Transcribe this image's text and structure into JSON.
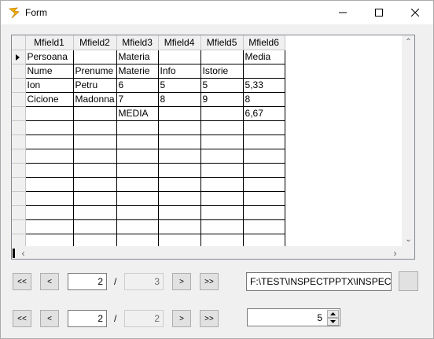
{
  "window": {
    "title": "Form"
  },
  "grid": {
    "columns": [
      "Mfield1",
      "Mfield2",
      "Mfield3",
      "Mfield4",
      "Mfield5",
      "Mfield6"
    ],
    "rows": [
      [
        "Persoana",
        "",
        "Materia",
        "",
        "",
        "Media"
      ],
      [
        "Nume",
        "Prenume",
        "Materie",
        "Info",
        "Istorie",
        ""
      ],
      [
        "Ion",
        "Petru",
        "6",
        "5",
        "5",
        "5,33"
      ],
      [
        "Cicione",
        "Madonna",
        "7",
        "8",
        "9",
        "8"
      ],
      [
        "",
        "",
        "MEDIA",
        "",
        "",
        "6,67"
      ],
      [
        "",
        "",
        "",
        "",
        "",
        ""
      ],
      [
        "",
        "",
        "",
        "",
        "",
        ""
      ],
      [
        "",
        "",
        "",
        "",
        "",
        ""
      ],
      [
        "",
        "",
        "",
        "",
        "",
        ""
      ],
      [
        "",
        "",
        "",
        "",
        "",
        ""
      ],
      [
        "",
        "",
        "",
        "",
        "",
        ""
      ],
      [
        "",
        "",
        "",
        "",
        "",
        ""
      ],
      [
        "",
        "",
        "",
        "",
        "",
        ""
      ],
      [
        "",
        "",
        "",
        "",
        "",
        ""
      ]
    ]
  },
  "nav1": {
    "first": "<<",
    "prev": "<",
    "current": "2",
    "sep": "/",
    "total": "3",
    "next": ">",
    "last": ">>"
  },
  "nav2": {
    "first": "<<",
    "prev": "<",
    "current": "2",
    "sep": "/",
    "total": "2",
    "next": ">",
    "last": ">>"
  },
  "path": {
    "value": "F:\\TEST\\INSPECTPPTX\\INSPECTPPTX"
  },
  "spinner": {
    "value": "5"
  }
}
